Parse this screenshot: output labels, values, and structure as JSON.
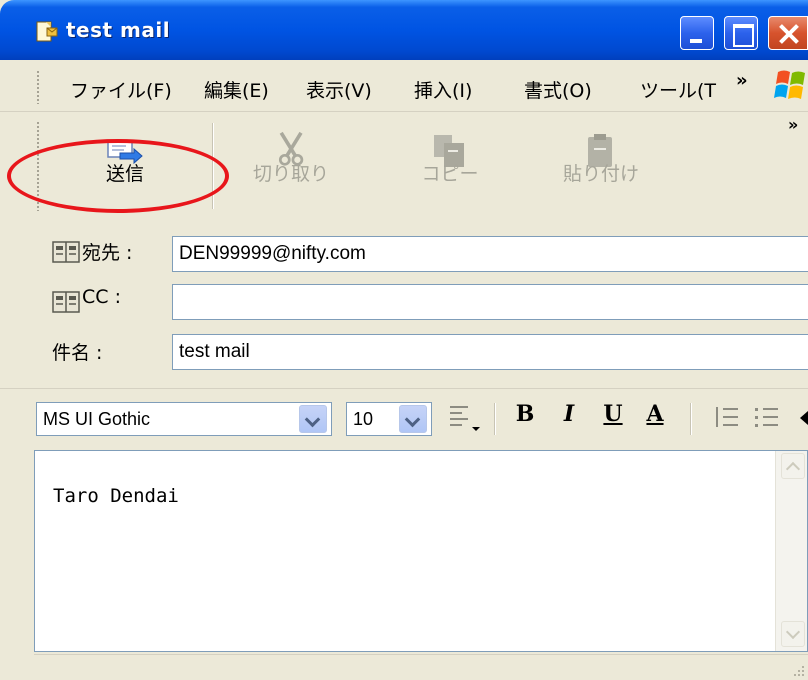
{
  "window": {
    "title": "test mail",
    "icon": "mail-document-icon",
    "controls": [
      "minimize",
      "maximize",
      "close"
    ]
  },
  "menu": {
    "items": [
      {
        "label": "ファイル(F)"
      },
      {
        "label": "編集(E)"
      },
      {
        "label": "表示(V)"
      },
      {
        "label": "挿入(I)"
      },
      {
        "label": "書式(O)"
      },
      {
        "label": "ツール(T"
      }
    ],
    "overflow": "»"
  },
  "toolbar": {
    "send_label": "送信",
    "cut_label": "切り取り",
    "copy_label": "コピー",
    "paste_label": "貼り付け",
    "overflow": "»"
  },
  "fields": {
    "to_label": "宛先 :",
    "to_value": "DEN99999@nifty.com",
    "cc_label": "CC :",
    "cc_value": "",
    "subject_label": "件名 :",
    "subject_value": "test mail"
  },
  "format": {
    "font": "MS UI Gothic",
    "size": "10",
    "bold": "B",
    "italic": "I",
    "underline": "U",
    "font_color": "A"
  },
  "body": {
    "text": "Taro Dendai"
  },
  "colors": {
    "titlebar": "#0054e3",
    "highlight": "#e8161b",
    "disabled_text": "#a7a69a"
  }
}
